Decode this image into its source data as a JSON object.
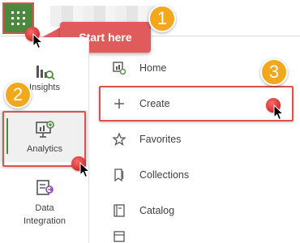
{
  "callout": {
    "text": "Start here"
  },
  "steps": [
    "1",
    "2",
    "3"
  ],
  "rail": {
    "items": [
      {
        "label": "Insights"
      },
      {
        "label": "Analytics"
      },
      {
        "label": "Data",
        "label2": "Integration"
      }
    ]
  },
  "menu": {
    "items": [
      {
        "label": "Home",
        "icon": "home-chart-icon"
      },
      {
        "label": "Create",
        "icon": "plus-icon"
      },
      {
        "label": "Favorites",
        "icon": "star-icon"
      },
      {
        "label": "Collections",
        "icon": "bookmark-icon"
      },
      {
        "label": "Catalog",
        "icon": "catalog-icon"
      }
    ]
  },
  "colors": {
    "accent_green": "#4b8a3c",
    "highlight_red": "#d9534f",
    "badge_orange": "#f3a81c",
    "callout_red": "#e05b5b"
  }
}
